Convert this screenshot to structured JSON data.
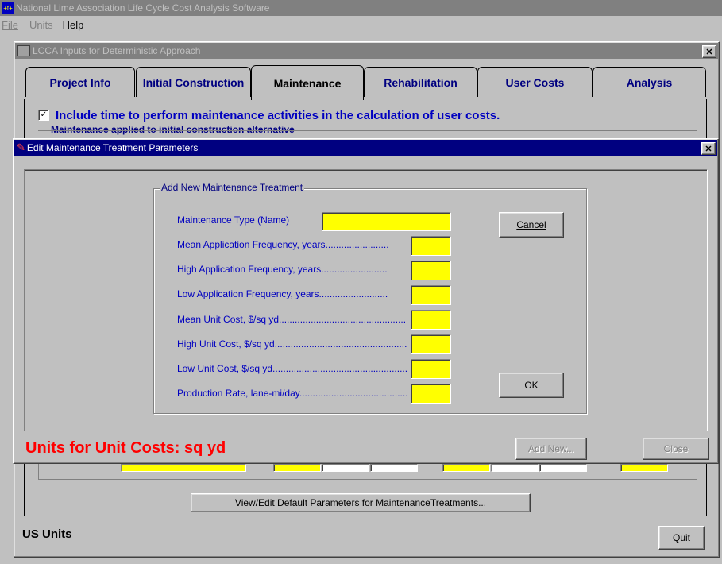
{
  "app": {
    "title": "National Lime Association Life Cycle Cost Analysis Software",
    "menu": [
      "File",
      "Units",
      "Help"
    ]
  },
  "child_window": {
    "title": "LCCA Inputs for Deterministic Approach",
    "tabs": [
      "Project Info",
      "Initial Construction",
      "Maintenance",
      "Rehabilitation",
      "User Costs",
      "Analysis"
    ],
    "active_tab": "Maintenance",
    "include_time_checkbox": "Include time to perform maintenance activities in the calculation of user costs.",
    "maint_group_title": "Maintenance applied to initial construction alternative",
    "view_edit_button": "View/Edit Default Parameters for MaintenanceTreatments...",
    "units_label": "US Units",
    "quit_button": "Quit"
  },
  "dialog": {
    "title": "Edit Maintenance Treatment Parameters",
    "group_title": "Add New Maintenance Treatment",
    "fields": [
      {
        "label": "Maintenance Type (Name)",
        "value": ""
      },
      {
        "label": "Mean Application Frequency, years........................",
        "value": ""
      },
      {
        "label": "High Application Frequency, years.........................",
        "value": ""
      },
      {
        "label": "Low Application Frequency, years..........................",
        "value": ""
      },
      {
        "label": "Mean Unit Cost, $/sq yd.................................................",
        "value": ""
      },
      {
        "label": "High Unit Cost, $/sq yd..................................................",
        "value": ""
      },
      {
        "label": "Low Unit Cost, $/sq yd...................................................",
        "value": ""
      },
      {
        "label": "Production Rate, lane-mi/day...........................................",
        "value": ""
      }
    ],
    "cancel_button": "Cancel",
    "ok_button": "OK",
    "units_for_costs": "Units for Unit Costs: sq yd",
    "add_new_button": "Add New...",
    "close_button": "Close"
  },
  "colors": {
    "accent_red": "#ff0000",
    "field_yellow": "#ffff00",
    "title_active": "#000080"
  }
}
